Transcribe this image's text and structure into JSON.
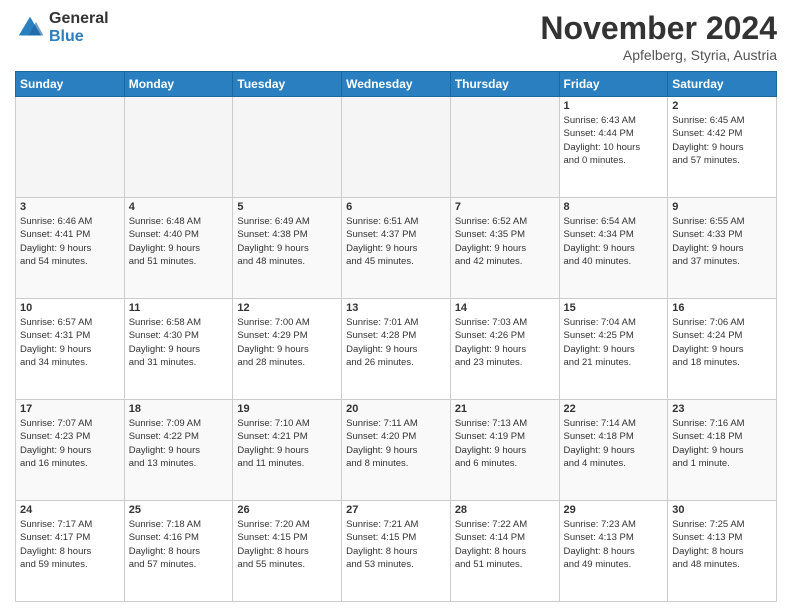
{
  "logo": {
    "general": "General",
    "blue": "Blue"
  },
  "header": {
    "month_year": "November 2024",
    "location": "Apfelberg, Styria, Austria"
  },
  "weekdays": [
    "Sunday",
    "Monday",
    "Tuesday",
    "Wednesday",
    "Thursday",
    "Friday",
    "Saturday"
  ],
  "weeks": [
    [
      {
        "day": "",
        "info": ""
      },
      {
        "day": "",
        "info": ""
      },
      {
        "day": "",
        "info": ""
      },
      {
        "day": "",
        "info": ""
      },
      {
        "day": "",
        "info": ""
      },
      {
        "day": "1",
        "info": "Sunrise: 6:43 AM\nSunset: 4:44 PM\nDaylight: 10 hours\nand 0 minutes."
      },
      {
        "day": "2",
        "info": "Sunrise: 6:45 AM\nSunset: 4:42 PM\nDaylight: 9 hours\nand 57 minutes."
      }
    ],
    [
      {
        "day": "3",
        "info": "Sunrise: 6:46 AM\nSunset: 4:41 PM\nDaylight: 9 hours\nand 54 minutes."
      },
      {
        "day": "4",
        "info": "Sunrise: 6:48 AM\nSunset: 4:40 PM\nDaylight: 9 hours\nand 51 minutes."
      },
      {
        "day": "5",
        "info": "Sunrise: 6:49 AM\nSunset: 4:38 PM\nDaylight: 9 hours\nand 48 minutes."
      },
      {
        "day": "6",
        "info": "Sunrise: 6:51 AM\nSunset: 4:37 PM\nDaylight: 9 hours\nand 45 minutes."
      },
      {
        "day": "7",
        "info": "Sunrise: 6:52 AM\nSunset: 4:35 PM\nDaylight: 9 hours\nand 42 minutes."
      },
      {
        "day": "8",
        "info": "Sunrise: 6:54 AM\nSunset: 4:34 PM\nDaylight: 9 hours\nand 40 minutes."
      },
      {
        "day": "9",
        "info": "Sunrise: 6:55 AM\nSunset: 4:33 PM\nDaylight: 9 hours\nand 37 minutes."
      }
    ],
    [
      {
        "day": "10",
        "info": "Sunrise: 6:57 AM\nSunset: 4:31 PM\nDaylight: 9 hours\nand 34 minutes."
      },
      {
        "day": "11",
        "info": "Sunrise: 6:58 AM\nSunset: 4:30 PM\nDaylight: 9 hours\nand 31 minutes."
      },
      {
        "day": "12",
        "info": "Sunrise: 7:00 AM\nSunset: 4:29 PM\nDaylight: 9 hours\nand 28 minutes."
      },
      {
        "day": "13",
        "info": "Sunrise: 7:01 AM\nSunset: 4:28 PM\nDaylight: 9 hours\nand 26 minutes."
      },
      {
        "day": "14",
        "info": "Sunrise: 7:03 AM\nSunset: 4:26 PM\nDaylight: 9 hours\nand 23 minutes."
      },
      {
        "day": "15",
        "info": "Sunrise: 7:04 AM\nSunset: 4:25 PM\nDaylight: 9 hours\nand 21 minutes."
      },
      {
        "day": "16",
        "info": "Sunrise: 7:06 AM\nSunset: 4:24 PM\nDaylight: 9 hours\nand 18 minutes."
      }
    ],
    [
      {
        "day": "17",
        "info": "Sunrise: 7:07 AM\nSunset: 4:23 PM\nDaylight: 9 hours\nand 16 minutes."
      },
      {
        "day": "18",
        "info": "Sunrise: 7:09 AM\nSunset: 4:22 PM\nDaylight: 9 hours\nand 13 minutes."
      },
      {
        "day": "19",
        "info": "Sunrise: 7:10 AM\nSunset: 4:21 PM\nDaylight: 9 hours\nand 11 minutes."
      },
      {
        "day": "20",
        "info": "Sunrise: 7:11 AM\nSunset: 4:20 PM\nDaylight: 9 hours\nand 8 minutes."
      },
      {
        "day": "21",
        "info": "Sunrise: 7:13 AM\nSunset: 4:19 PM\nDaylight: 9 hours\nand 6 minutes."
      },
      {
        "day": "22",
        "info": "Sunrise: 7:14 AM\nSunset: 4:18 PM\nDaylight: 9 hours\nand 4 minutes."
      },
      {
        "day": "23",
        "info": "Sunrise: 7:16 AM\nSunset: 4:18 PM\nDaylight: 9 hours\nand 1 minute."
      }
    ],
    [
      {
        "day": "24",
        "info": "Sunrise: 7:17 AM\nSunset: 4:17 PM\nDaylight: 8 hours\nand 59 minutes."
      },
      {
        "day": "25",
        "info": "Sunrise: 7:18 AM\nSunset: 4:16 PM\nDaylight: 8 hours\nand 57 minutes."
      },
      {
        "day": "26",
        "info": "Sunrise: 7:20 AM\nSunset: 4:15 PM\nDaylight: 8 hours\nand 55 minutes."
      },
      {
        "day": "27",
        "info": "Sunrise: 7:21 AM\nSunset: 4:15 PM\nDaylight: 8 hours\nand 53 minutes."
      },
      {
        "day": "28",
        "info": "Sunrise: 7:22 AM\nSunset: 4:14 PM\nDaylight: 8 hours\nand 51 minutes."
      },
      {
        "day": "29",
        "info": "Sunrise: 7:23 AM\nSunset: 4:13 PM\nDaylight: 8 hours\nand 49 minutes."
      },
      {
        "day": "30",
        "info": "Sunrise: 7:25 AM\nSunset: 4:13 PM\nDaylight: 8 hours\nand 48 minutes."
      }
    ]
  ]
}
